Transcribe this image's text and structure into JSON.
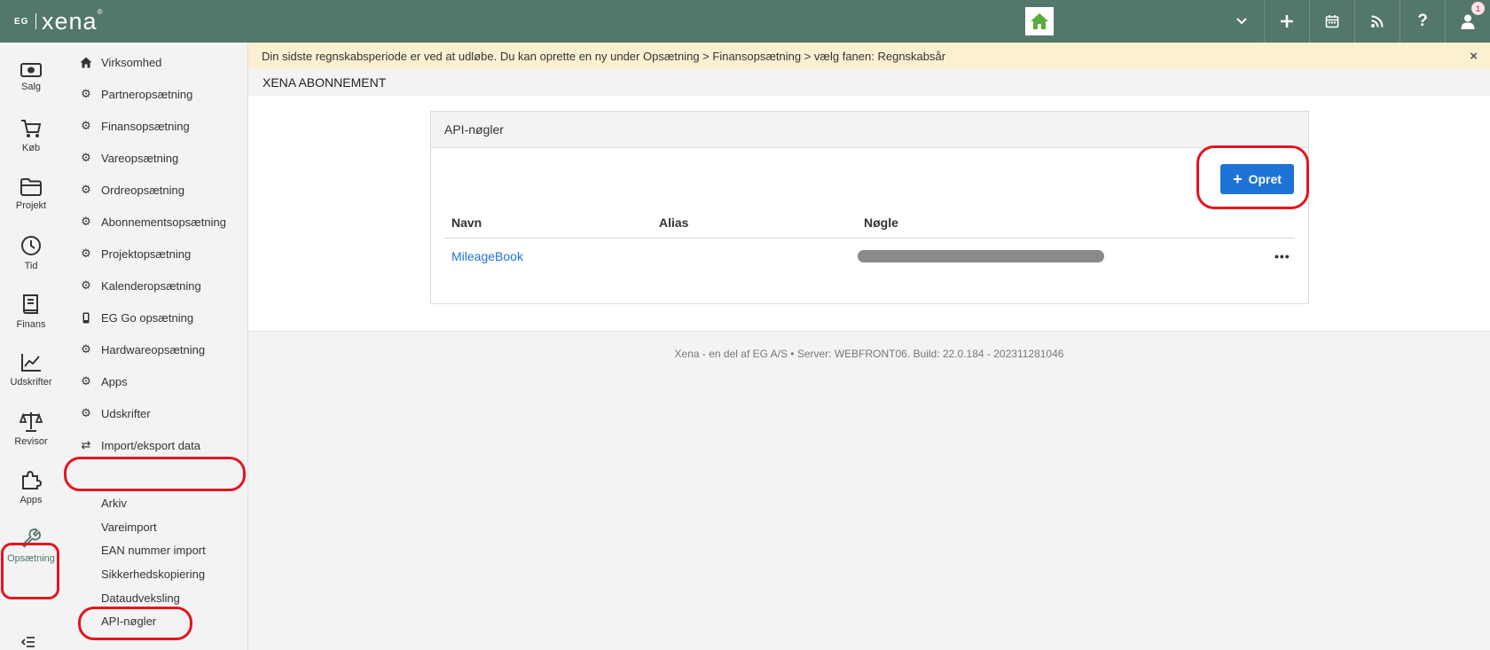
{
  "brand": {
    "eg": "EG",
    "name": "xena",
    "tm": "®"
  },
  "topbar": {
    "notification_count": "1"
  },
  "rail": [
    {
      "key": "salg",
      "label": "Salg",
      "icon": "money-icon"
    },
    {
      "key": "koeb",
      "label": "Køb",
      "icon": "cart-icon"
    },
    {
      "key": "projekt",
      "label": "Projekt",
      "icon": "folder-icon"
    },
    {
      "key": "tid",
      "label": "Tid",
      "icon": "clock-icon"
    },
    {
      "key": "finans",
      "label": "Finans",
      "icon": "book-icon"
    },
    {
      "key": "udskrifter",
      "label": "Udskrifter",
      "icon": "line-chart-icon"
    },
    {
      "key": "revisor",
      "label": "Revisor",
      "icon": "scales-icon"
    },
    {
      "key": "apps",
      "label": "Apps",
      "icon": "puzzle-icon"
    },
    {
      "key": "opsaetning",
      "label": "Opsætning",
      "icon": "wrench-icon"
    }
  ],
  "nav": {
    "items": [
      {
        "label": "Virksomhed",
        "icon": "home-icon"
      },
      {
        "label": "Partneropsætning",
        "icon": "gear-icon"
      },
      {
        "label": "Finansopsætning",
        "icon": "gear-icon"
      },
      {
        "label": "Vareopsætning",
        "icon": "gear-icon"
      },
      {
        "label": "Ordreopsætning",
        "icon": "gear-icon"
      },
      {
        "label": "Abonnementsopsætning",
        "icon": "gear-icon"
      },
      {
        "label": "Projektopsætning",
        "icon": "gear-icon"
      },
      {
        "label": "Kalenderopsætning",
        "icon": "gear-icon"
      },
      {
        "label": "EG Go opsætning",
        "icon": "mobile-icon"
      },
      {
        "label": "Hardwareopsætning",
        "icon": "gear-icon"
      },
      {
        "label": "Apps",
        "icon": "gear-icon"
      },
      {
        "label": "Udskrifter",
        "icon": "gear-icon"
      },
      {
        "label": "Import/eksport data",
        "icon": "swap-icon"
      }
    ],
    "subitems": [
      "Arkiv",
      "Vareimport",
      "EAN nummer import",
      "Sikkerhedskopiering",
      "Dataudveksling",
      "API-nøgler"
    ]
  },
  "notice": {
    "text": "Din sidste regnskabsperiode er ved at udløbe. Du kan oprette en ny under Opsætning > Finansopsætning > vælg fanen: Regnskabsår",
    "close": "×"
  },
  "page": {
    "title": "XENA ABONNEMENT"
  },
  "panel": {
    "title": "API-nøgler",
    "create_label": "Opret",
    "columns": [
      "Navn",
      "Alias",
      "Nøgle"
    ],
    "rows": [
      {
        "name": "MileageBook",
        "alias": "",
        "menu": "•••"
      }
    ]
  },
  "footer": {
    "text": "Xena - en del af EG A/S  •  Server: WEBFRONT06. Build: 22.0.184 - 202311281046"
  },
  "colors": {
    "topbar": "#537769",
    "accent": "#1e73d6",
    "annotation": "#e3151f",
    "notice": "#fbf1d1"
  }
}
